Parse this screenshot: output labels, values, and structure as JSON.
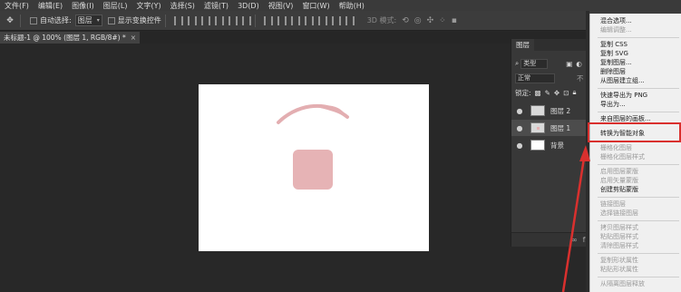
{
  "menubar": {
    "items": [
      "文件(F)",
      "编辑(E)",
      "图像(I)",
      "图层(L)",
      "文字(Y)",
      "选择(S)",
      "滤镜(T)",
      "3D(D)",
      "视图(V)",
      "窗口(W)",
      "帮助(H)"
    ]
  },
  "options": {
    "auto_select_label": "自动选择:",
    "auto_select_value": "图层",
    "show_transform_label": "显示变换控件",
    "mode_3d_label": "3D 模式:"
  },
  "document_tab": {
    "title": "未标题-1 @ 100% (图层 1, RGB/8#) *",
    "close_glyph": "×"
  },
  "layers_panel": {
    "tab_label": "图层",
    "filter_kind": "类型",
    "blend_mode": "正常",
    "opacity_abbrev": "不",
    "lock_label": "锁定:",
    "layers": [
      {
        "name": "图层 2",
        "selected": false
      },
      {
        "name": "图层 1",
        "selected": true
      },
      {
        "name": "背景",
        "selected": false
      }
    ],
    "footer_fx": "fx"
  },
  "context_menu": {
    "items": [
      {
        "label": "混合选项...",
        "disabled": false
      },
      {
        "label": "编辑调整...",
        "disabled": true
      },
      {
        "label": "复制 CSS",
        "disabled": false
      },
      {
        "label": "复制 SVG",
        "disabled": false
      },
      {
        "label": "复制图层...",
        "disabled": false
      },
      {
        "label": "删除图层",
        "disabled": false
      },
      {
        "label": "从图层建立组...",
        "disabled": false
      },
      {
        "label": "快速导出为 PNG",
        "disabled": false
      },
      {
        "label": "导出为...",
        "disabled": false
      },
      {
        "label": "来自图层的画板...",
        "disabled": false
      },
      {
        "label": "转换为智能对象",
        "disabled": false
      },
      {
        "label": "栅格化图层",
        "disabled": true
      },
      {
        "label": "栅格化图层样式",
        "disabled": true
      },
      {
        "label": "启用图层蒙版",
        "disabled": true
      },
      {
        "label": "启用矢量蒙版",
        "disabled": true
      },
      {
        "label": "创建剪贴蒙版",
        "disabled": false
      },
      {
        "label": "链接图层",
        "disabled": true
      },
      {
        "label": "选择链接图层",
        "disabled": true
      },
      {
        "label": "拷贝图层样式",
        "disabled": true
      },
      {
        "label": "粘贴图层样式",
        "disabled": true
      },
      {
        "label": "清除图层样式",
        "disabled": true
      },
      {
        "label": "复制形状属性",
        "disabled": true
      },
      {
        "label": "粘贴形状属性",
        "disabled": true
      },
      {
        "label": "从隔离图层释放",
        "disabled": true
      }
    ]
  },
  "colors": {
    "highlight_annotation": "#d9302e",
    "shape_fill": "#e6b3b5",
    "arc_stroke": "#e3aeb1"
  }
}
